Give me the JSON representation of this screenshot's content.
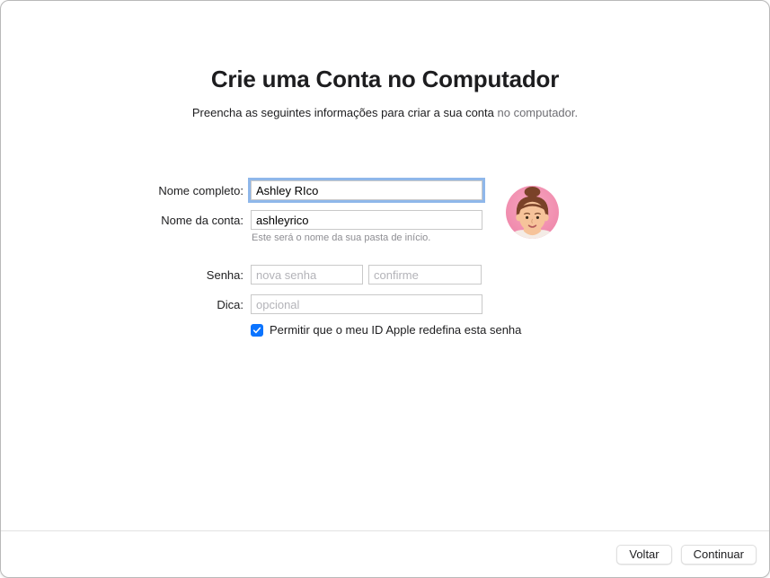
{
  "header": {
    "title": "Crie uma Conta no Computador",
    "subtitle_main": "Preencha as seguintes informações para criar a sua conta ",
    "subtitle_muted": "no computador."
  },
  "form": {
    "full_name": {
      "label": "Nome completo:",
      "value": "Ashley RIco"
    },
    "account_name": {
      "label": "Nome da conta:",
      "value": "ashleyrico",
      "helper": "Este será o nome da sua pasta de início."
    },
    "password": {
      "label": "Senha:",
      "new_placeholder": "nova senha",
      "confirm_placeholder": "confirme"
    },
    "hint": {
      "label": "Dica:",
      "placeholder": "opcional"
    },
    "allow_reset": {
      "checked": true,
      "label": "Permitir que o meu ID Apple redefina esta senha"
    }
  },
  "footer": {
    "back": "Voltar",
    "continue": "Continuar"
  }
}
